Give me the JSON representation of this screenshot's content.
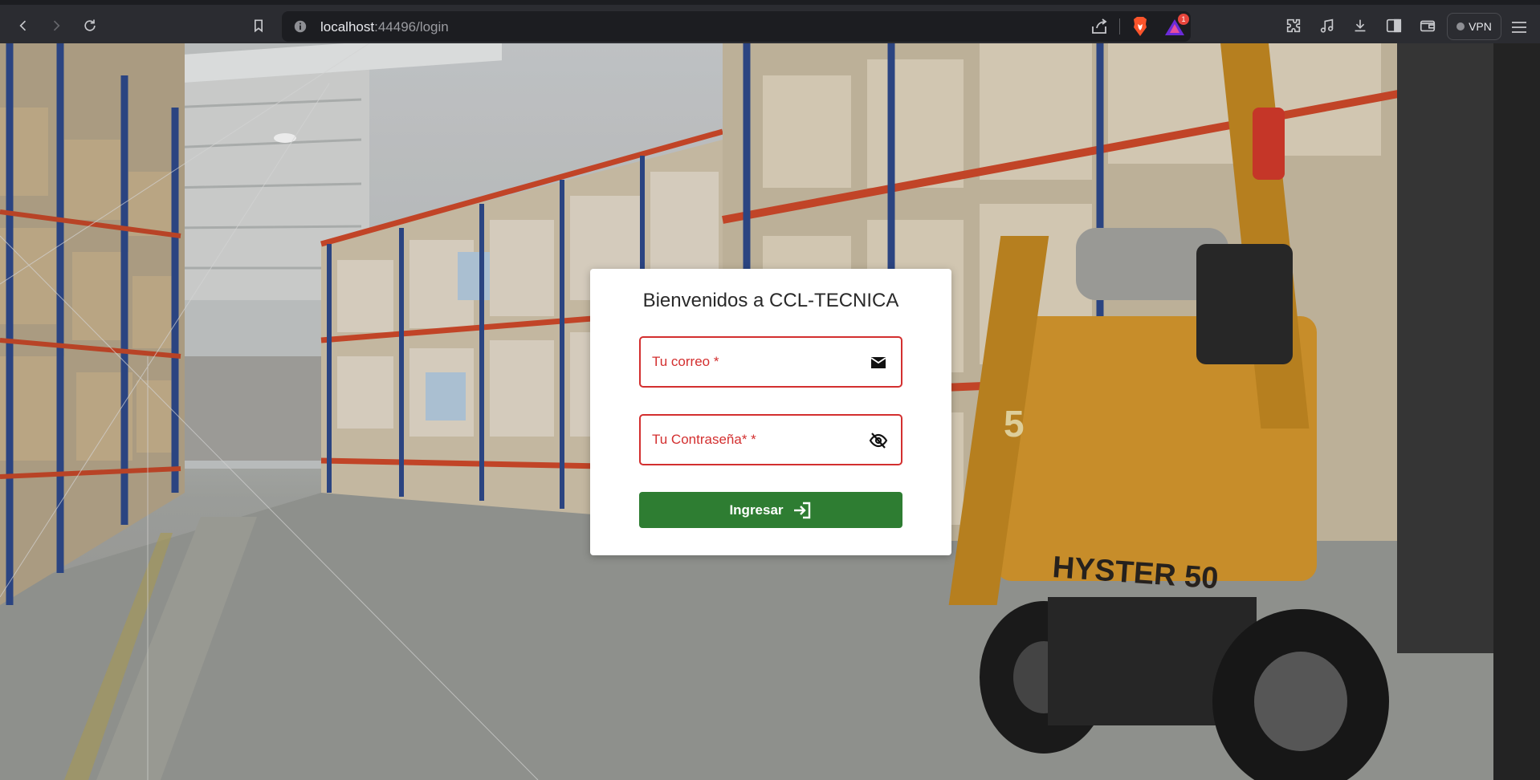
{
  "browser": {
    "url_host": "localhost",
    "url_rest": ":44496/login",
    "rewards_badge": "1",
    "vpn_label": "VPN",
    "icons": [
      "back-icon",
      "forward-icon",
      "reload-icon",
      "bookmark-icon",
      "site-info-icon",
      "share-icon",
      "brave-shields-icon",
      "brave-rewards-icon",
      "extensions-icon",
      "media-icon",
      "downloads-icon",
      "sidebar-icon",
      "wallet-icon",
      "menu-icon"
    ]
  },
  "login": {
    "title": "Bienvenidos a CCL-TECNICA",
    "email_placeholder": "Tu correo *",
    "password_placeholder": "Tu Contraseña* *",
    "submit_label": "Ingresar",
    "error_color": "#d32f2f",
    "button_color": "#2e7d32",
    "icons": {
      "email": "mail-icon",
      "password": "eye-off-icon",
      "submit": "login-icon"
    }
  },
  "background": {
    "description_color_floor": "#9c9d98",
    "forklift_brand": "HYSTER 50",
    "forklift_number": "5"
  }
}
